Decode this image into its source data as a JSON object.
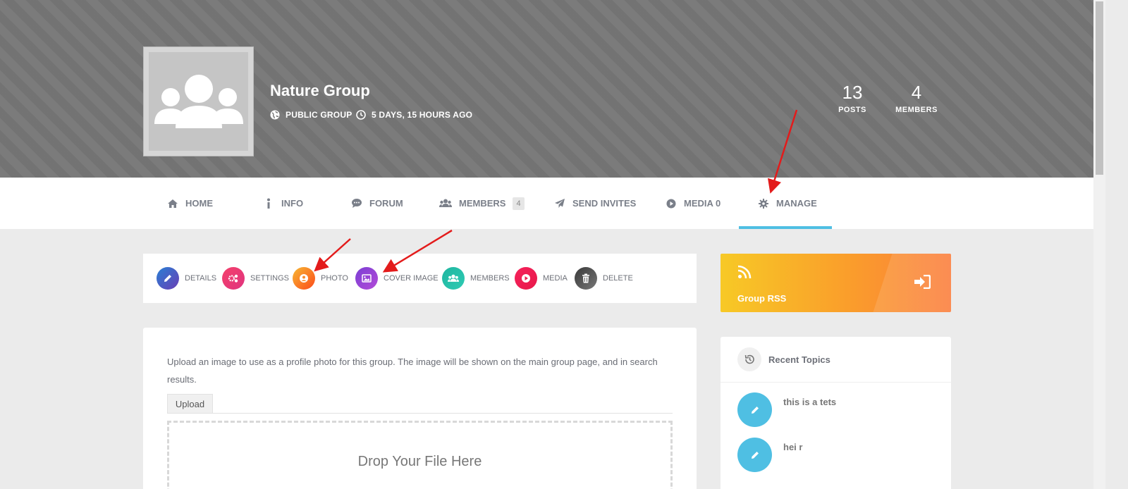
{
  "group": {
    "name": "Nature Group",
    "privacy": "PUBLIC GROUP",
    "active": "5 DAYS, 15 HOURS AGO"
  },
  "stats": [
    {
      "value": "13",
      "label": "POSTS"
    },
    {
      "value": "4",
      "label": "MEMBERS"
    }
  ],
  "nav": {
    "home": "HOME",
    "info": "INFO",
    "forum": "FORUM",
    "members": "MEMBERS",
    "members_count": "4",
    "send_invites": "SEND INVITES",
    "media": "MEDIA 0",
    "manage": "MANAGE"
  },
  "manage_menu": {
    "details": "DETAILS",
    "settings": "SETTINGS",
    "photo": "PHOTO",
    "cover_image": "COVER IMAGE",
    "members": "MEMBERS",
    "media": "MEDIA",
    "delete": "DELETE"
  },
  "content": {
    "description": "Upload an image to use as a profile photo for this group. The image will be shown on the main group page, and in search results.",
    "upload_tab": "Upload",
    "drop_text": "Drop Your File Here"
  },
  "sidebar": {
    "rss_title": "Group RSS",
    "recent_topics_title": "Recent Topics",
    "topics": [
      {
        "title": "this is a tets"
      },
      {
        "title": "hei r"
      }
    ]
  },
  "colors": {
    "accent": "#4fbfe3",
    "annotation_arrow": "#e31b1b"
  }
}
